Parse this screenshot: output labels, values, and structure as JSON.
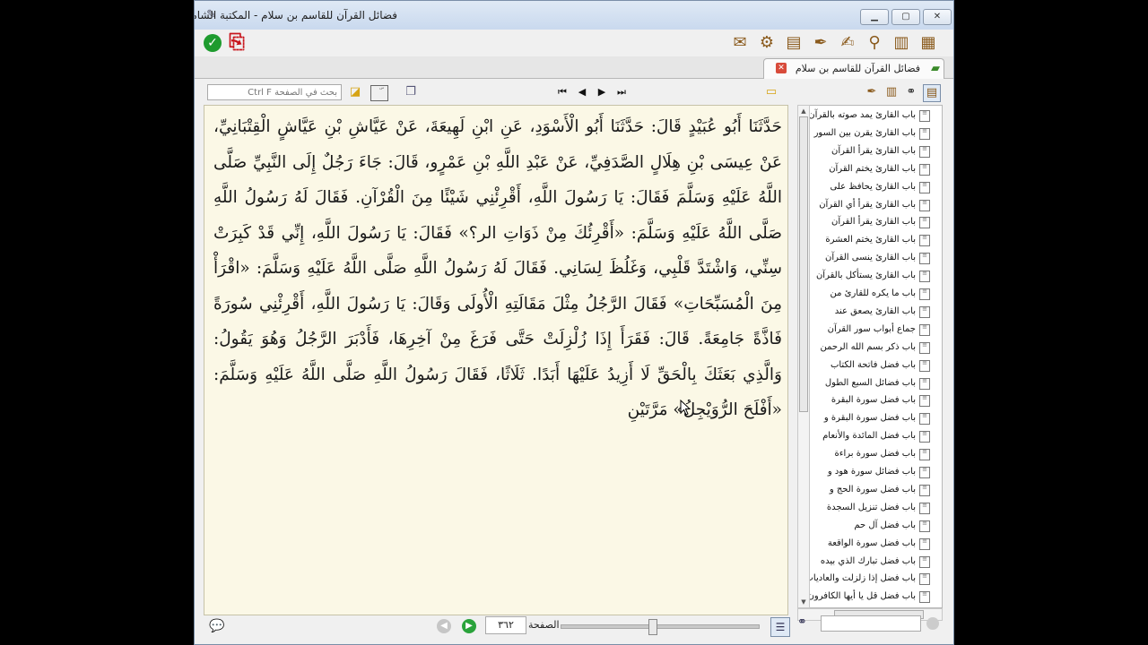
{
  "window": {
    "title": "فضائل القرآن للقاسم بن سلام - المكتبة الشاملة",
    "controls": {
      "minimize": "▭",
      "maximize": "▢",
      "close": "✕"
    }
  },
  "toolbar": {
    "left_icons": [
      "check-icon",
      "pdf-icon"
    ],
    "right_icons": [
      "mail-icon",
      "gear-icon",
      "terminal-icon",
      "quill-icon",
      "edit-icon",
      "search-icon",
      "open-book-icon",
      "books-icon"
    ]
  },
  "tab": {
    "title": "فضائل القرآن للقاسم بن سلام"
  },
  "reader": {
    "search_placeholder": "بحث في الصفحة Ctrl F",
    "text": "حَدَّثَنَا أَبُو عُبَيْدٍ قَالَ: حَدَّثَنَا أَبُو الْأَسْوَدِ، عَنِ ابْنِ لَهِيعَةَ، عَنْ عَيَّاشِ بْنِ عَيَّاشٍ الْقِتْبَانِيِّ، عَنْ عِيسَى بْنِ هِلَالٍ الصَّدَفِيِّ، عَنْ عَبْدِ اللَّهِ بْنِ عَمْرٍو، قَالَ: جَاءَ رَجُلٌ إِلَى النَّبِيِّ صَلَّى اللَّهُ عَلَيْهِ وَسَلَّمَ فَقَالَ: يَا رَسُولَ اللَّهِ، أَقْرِئْنِي شَيْئًا مِنَ الْقُرْآنِ. فَقَالَ لَهُ رَسُولُ اللَّهِ صَلَّى اللَّهُ عَلَيْهِ وَسَلَّمَ: «أَقْرِئُكَ مِنْ ذَوَاتِ الر؟» فَقَالَ: يَا رَسُولَ اللَّهِ، إِنِّي قَدْ كَبِرَتْ سِنِّي، وَاشْتَدَّ قَلْبِي، وَغَلُظَ لِسَانِي. فَقَالَ لَهُ رَسُولُ اللَّهِ صَلَّى اللَّهُ عَلَيْهِ وَسَلَّمَ: «اقْرَأْ مِنَ الْمُسَبِّحَاتِ» فَقَالَ الرَّجُلُ مِثْلَ مَقَالَتِهِ الْأُولَى وَقَالَ: يَا رَسُولَ اللَّهِ، أَقْرِئْنِي سُورَةً فَاذَّةً جَامِعَةً. قَالَ: فَقَرَأَ إِذَا زُلْزِلَتْ حَتَّى فَرَغَ مِنْ آخِرِهَا، فَأَدْبَرَ الرَّجُلُ وَهُوَ يَقُولُ: وَالَّذِي بَعَثَكَ بِالْحَقِّ لَا أَزِيدُ عَلَيْهَا أَبَدًا. ثَلَاثًا، فَقَالَ رَسُولُ اللَّهِ صَلَّى اللَّهُ عَلَيْهِ وَسَلَّمَ: «أَفْلَحَ الرُّوَيْجِلُ» مَرَّتَيْنِ"
  },
  "status": {
    "page_label": "الصفحة",
    "page_number": "٣٦٢",
    "slider_position": 0.46
  },
  "sidebar": {
    "items": [
      "باب القارئ يمد صوته بالقرآن",
      "باب القارئ يقرن بين السور",
      "باب القارئ يقرأ القرآن",
      "باب القارئ يختم القرآن",
      "باب القارئ يحافظ على",
      "باب القارئ يقرأ أي القرآن",
      "باب القارئ يقرأ القرآن",
      "باب القارئ يختم العشرة",
      "باب القارئ ينسى القرآن",
      "باب القارئ يستأكل بالقرآن",
      "باب ما يكره للقارئ من",
      "باب القارئ يصعق عند",
      "جماع أبواب سور القرآن",
      "باب ذكر بسم الله الرحمن",
      "باب فضل فاتحة الكتاب",
      "باب فضائل السبع الطول",
      "باب فضل سورة البقرة",
      "باب فضل سورة البقرة و",
      "باب فضل المائدة والأنعام",
      "باب فضل سورة براءة",
      "باب فضائل سورة هود و",
      "باب فضل سورة الحج و",
      "باب فضل تنزيل السجدة",
      "باب فضل آل حم",
      "باب فضل سورة الواقعة",
      "باب فضل تبارك الذي بيده",
      "باب فضل إذا زلزلت والعاديات",
      "باب فضل قل يا أيها الكافرون"
    ]
  }
}
